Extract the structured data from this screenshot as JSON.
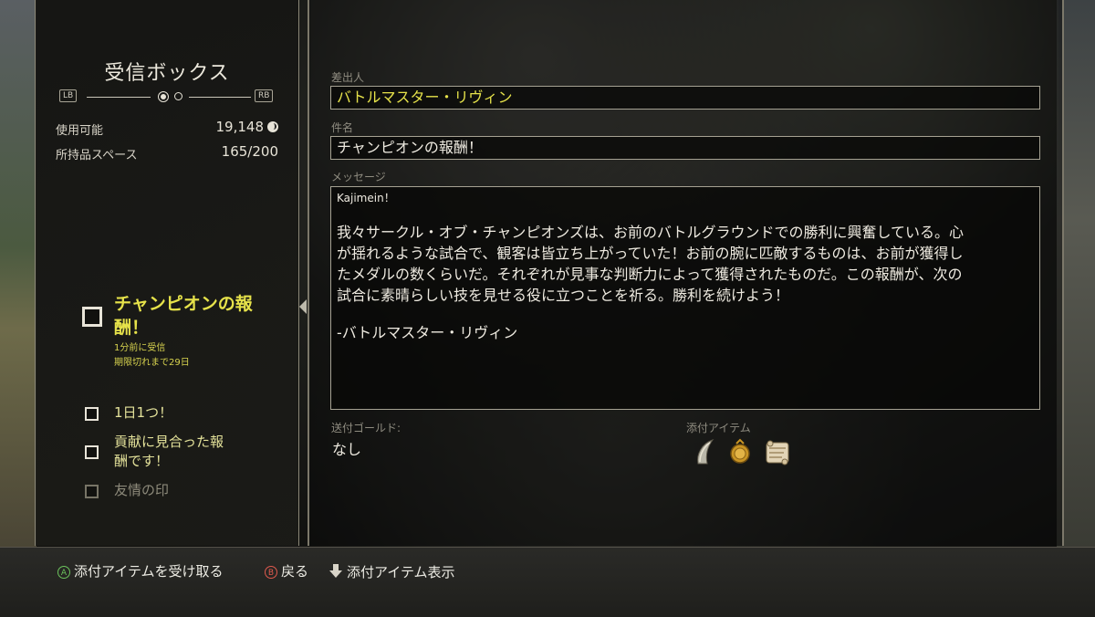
{
  "inbox": {
    "title": "受信ボックス",
    "lb_label": "LB",
    "rb_label": "RB",
    "stats": {
      "usable_label": "使用可能",
      "usable_value": "19,148",
      "space_label": "所持品スペース",
      "space_value": "165/200"
    }
  },
  "mail_list": {
    "selected": {
      "title_line1": "チャンピオンの報",
      "title_line2": "酬！",
      "received": "1分前に受信",
      "expires": "期限切れまで29日"
    },
    "items": [
      {
        "label": "1日1つ！",
        "disabled": false
      },
      {
        "label_line1": "貢献に見合った報",
        "label_line2": "酬です！",
        "disabled": false
      },
      {
        "label": "友情の印",
        "disabled": true
      }
    ]
  },
  "detail": {
    "sender_label": "差出人",
    "sender_value": "バトルマスター・リヴィン",
    "subject_label": "件名",
    "subject_value": "チャンピオンの報酬！",
    "message_label": "メッセージ",
    "message_lines": [
      "Kajimein！",
      "",
      "我々サークル・オブ・チャンピオンズは、お前のバトルグラウンドでの勝利に興奮している。心",
      "が揺れるような試合で、観客は皆立ち上がっていた！お前の腕に匹敵するものは、お前が獲得し",
      "たメダルの数くらいだ。それぞれが見事な判断力によって獲得されたものだ。この報酬が、次の",
      "試合に素晴らしい技を見せる役に立つことを祈る。勝利を続けよう！",
      "",
      "-バトルマスター・リヴィン"
    ],
    "gold_label": "送付ゴールド:",
    "gold_value": "なし",
    "attach_label": "添付アイテム",
    "attachments": [
      "horn-item-icon",
      "coin-item-icon",
      "scroll-item-icon"
    ]
  },
  "footer": {
    "a_button": "A",
    "take_label": "添付アイテムを受け取る",
    "b_button": "B",
    "back_label": "戻る",
    "show_label": "添付アイテム表示"
  },
  "colors": {
    "highlight": "#e6e24a",
    "a_button": "#6cc35c",
    "b_button": "#e05a4e"
  }
}
